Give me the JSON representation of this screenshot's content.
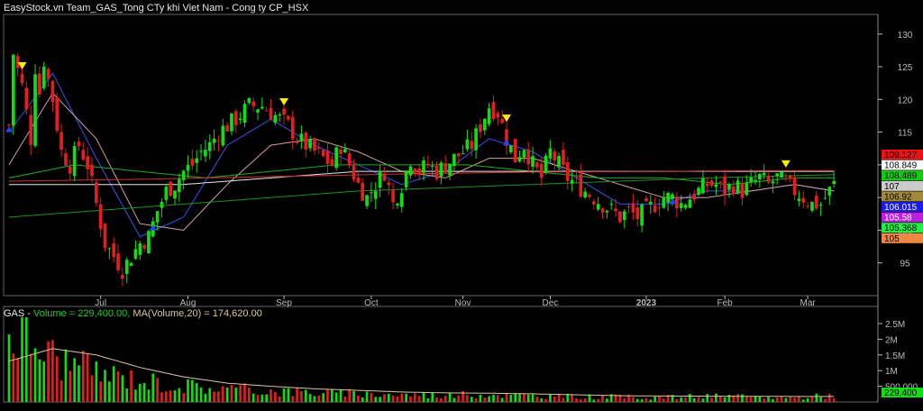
{
  "window": {
    "title": "EasyStock.vn Team_GAS_Tong CTy khi Viet Nam - Cong ty CP_HSX"
  },
  "volume_header": {
    "symbol": "GAS - ",
    "volume_text": "Volume = 229,400.00, ",
    "ma_text": "MA(Volume,20) = 174,620.00"
  },
  "colors": {
    "up": "#11dd11",
    "down": "#e21e1e",
    "background": "#000000",
    "axis": "#bbbbbb",
    "marker_yellow": "#ffee00",
    "marker_blue": "#2244ff"
  },
  "chart_data": [
    {
      "type": "candlestick",
      "title": "EasyStock.vn Team_GAS_Tong CTy khi Viet Nam - Cong ty CP_HSX",
      "ylim": [
        90,
        133
      ],
      "y_ticks": [
        95,
        100,
        105,
        110,
        115,
        120,
        125,
        130
      ],
      "x_labels": [
        "Jul",
        "Aug",
        "Sep",
        "Oct",
        "Nov",
        "Dec",
        "2023",
        "Feb",
        "Mar"
      ],
      "x_label_bar_index": [
        21,
        41,
        63,
        83,
        104,
        124,
        146,
        164,
        183
      ],
      "bar_count": 190,
      "close_anchors": [
        [
          0,
          116
        ],
        [
          1,
          127
        ],
        [
          3,
          122
        ],
        [
          5,
          114
        ],
        [
          6,
          125
        ],
        [
          7,
          121
        ],
        [
          8,
          126
        ],
        [
          10,
          120
        ],
        [
          12,
          112
        ],
        [
          14,
          110
        ],
        [
          16,
          113
        ],
        [
          18,
          110
        ],
        [
          20,
          104
        ],
        [
          22,
          98
        ],
        [
          24,
          96
        ],
        [
          26,
          94
        ],
        [
          28,
          96
        ],
        [
          30,
          98
        ],
        [
          32,
          99
        ],
        [
          34,
          103
        ],
        [
          36,
          106
        ],
        [
          38,
          107
        ],
        [
          40,
          109
        ],
        [
          42,
          110
        ],
        [
          44,
          112
        ],
        [
          46,
          113
        ],
        [
          48,
          115
        ],
        [
          50,
          116
        ],
        [
          52,
          117
        ],
        [
          55,
          119
        ],
        [
          58,
          119
        ],
        [
          60,
          118
        ],
        [
          62,
          117
        ],
        [
          64,
          116
        ],
        [
          66,
          114
        ],
        [
          68,
          113
        ],
        [
          70,
          112
        ],
        [
          72,
          111
        ],
        [
          74,
          110
        ],
        [
          76,
          113
        ],
        [
          78,
          110
        ],
        [
          80,
          107
        ],
        [
          82,
          105
        ],
        [
          84,
          107
        ],
        [
          86,
          109
        ],
        [
          88,
          104
        ],
        [
          90,
          107
        ],
        [
          92,
          111
        ],
        [
          94,
          109
        ],
        [
          96,
          110
        ],
        [
          98,
          109
        ],
        [
          100,
          110
        ],
        [
          102,
          111
        ],
        [
          104,
          112
        ],
        [
          106,
          113
        ],
        [
          108,
          116
        ],
        [
          110,
          119
        ],
        [
          112,
          118
        ],
        [
          114,
          114
        ],
        [
          116,
          111
        ],
        [
          118,
          113
        ],
        [
          120,
          110
        ],
        [
          122,
          108
        ],
        [
          124,
          112
        ],
        [
          126,
          110
        ],
        [
          128,
          108
        ],
        [
          130,
          107
        ],
        [
          132,
          106
        ],
        [
          134,
          105
        ],
        [
          136,
          104
        ],
        [
          138,
          103
        ],
        [
          140,
          102
        ],
        [
          142,
          103
        ],
        [
          144,
          102
        ],
        [
          146,
          103
        ],
        [
          148,
          104
        ],
        [
          150,
          105
        ],
        [
          152,
          105
        ],
        [
          154,
          104
        ],
        [
          156,
          105
        ],
        [
          158,
          106
        ],
        [
          160,
          107
        ],
        [
          162,
          107
        ],
        [
          164,
          106
        ],
        [
          166,
          107
        ],
        [
          168,
          106
        ],
        [
          170,
          107
        ],
        [
          172,
          108
        ],
        [
          174,
          107
        ],
        [
          176,
          108
        ],
        [
          178,
          107
        ],
        [
          180,
          106
        ],
        [
          182,
          105
        ],
        [
          184,
          104
        ],
        [
          186,
          104
        ],
        [
          188,
          106
        ],
        [
          189,
          107
        ]
      ],
      "series": [
        {
          "name": "",
          "color": "#3355ee",
          "anchors": [
            [
              0,
              115
            ],
            [
              10,
              124
            ],
            [
              20,
              111
            ],
            [
              30,
              99
            ],
            [
              40,
              102
            ],
            [
              50,
              113
            ],
            [
              60,
              117
            ],
            [
              70,
              113
            ],
            [
              80,
              110
            ],
            [
              90,
              107
            ],
            [
              100,
              109
            ],
            [
              110,
              114
            ],
            [
              120,
              112
            ],
            [
              130,
              108
            ],
            [
              140,
              104
            ],
            [
              150,
              104
            ],
            [
              160,
              106
            ],
            [
              170,
              106
            ],
            [
              180,
              107
            ],
            [
              189,
              106
            ]
          ]
        },
        {
          "name": "",
          "color": "#d4a0a0",
          "anchors": [
            [
              0,
              110
            ],
            [
              10,
              121
            ],
            [
              20,
              114
            ],
            [
              30,
              101
            ],
            [
              40,
              100
            ],
            [
              50,
              107
            ],
            [
              60,
              113
            ],
            [
              70,
              114
            ],
            [
              80,
              112
            ],
            [
              90,
              109
            ],
            [
              100,
              108
            ],
            [
              110,
              111
            ],
            [
              120,
              111
            ],
            [
              130,
              109
            ],
            [
              140,
              107
            ],
            [
              150,
              105
            ],
            [
              160,
              105
            ],
            [
              170,
              106
            ],
            [
              180,
              107
            ],
            [
              189,
              106
            ]
          ]
        },
        {
          "name": "",
          "color": "#22aa22",
          "anchors": [
            [
              0,
              108
            ],
            [
              15,
              110
            ],
            [
              30,
              109
            ],
            [
              45,
              108
            ],
            [
              60,
              109
            ],
            [
              75,
              110
            ],
            [
              90,
              110
            ],
            [
              105,
              110
            ],
            [
              120,
              109
            ],
            [
              135,
              108
            ],
            [
              150,
              108
            ],
            [
              165,
              107
            ],
            [
              180,
              108
            ],
            [
              189,
              108
            ]
          ]
        },
        {
          "name": "",
          "color": "#e8e8e8",
          "anchors": [
            [
              0,
              107
            ],
            [
              20,
              107
            ],
            [
              40,
              107
            ],
            [
              60,
              108
            ],
            [
              80,
              109
            ],
            [
              100,
              109
            ],
            [
              120,
              109
            ],
            [
              140,
              109
            ],
            [
              160,
              109
            ],
            [
              180,
              109
            ],
            [
              189,
              109
            ]
          ]
        },
        {
          "name": "",
          "color": "#cc3333",
          "anchors": [
            [
              0,
              107.5
            ],
            [
              30,
              107.8
            ],
            [
              60,
              108.2
            ],
            [
              90,
              108.6
            ],
            [
              120,
              108.9
            ],
            [
              150,
              109
            ],
            [
              170,
              109.1
            ],
            [
              189,
              109.1
            ]
          ]
        },
        {
          "name": "",
          "color": "#1f8f1f",
          "anchors": [
            [
              0,
              102
            ],
            [
              40,
              104
            ],
            [
              80,
              106
            ],
            [
              120,
              107
            ],
            [
              160,
              108
            ],
            [
              189,
              108.5
            ]
          ]
        }
      ],
      "markers_yellow": [
        3,
        63,
        114,
        178
      ],
      "markers_blue": [
        0,
        33,
        114,
        152
      ],
      "price_labels": [
        {
          "value": "109.127",
          "bg": "#ee1111",
          "fg": "#000000"
        },
        {
          "value": "108.849",
          "bg": "#ffffff",
          "fg": "#000000"
        },
        {
          "value": "108.489",
          "bg": "#11cc11",
          "fg": "#000000"
        },
        {
          "value": "107",
          "bg": "#cccccc",
          "fg": "#000000"
        },
        {
          "value": "106.92",
          "bg": "#a08a3a",
          "fg": "#000000"
        },
        {
          "value": "106.015",
          "bg": "#1a1aee",
          "fg": "#ffffff"
        },
        {
          "value": "105.58",
          "bg": "#bb22dd",
          "fg": "#ffffff"
        },
        {
          "value": "105.368",
          "bg": "#22ee44",
          "fg": "#000000"
        },
        {
          "value": "105",
          "bg": "#ee8844",
          "fg": "#000000"
        }
      ]
    },
    {
      "type": "bar",
      "title": "GAS - Volume = 229,400.00, MA(Volume,20) = 174,620.00",
      "ylim": [
        0,
        2700000
      ],
      "y_ticks": [
        {
          "value": 500000,
          "label": "500,000"
        },
        {
          "value": 1000000,
          "label": "1M"
        },
        {
          "value": 1500000,
          "label": "1.5M"
        },
        {
          "value": 2000000,
          "label": "2M"
        },
        {
          "value": 2500000,
          "label": "2.5M"
        }
      ],
      "last_value_label": "229,400",
      "volume_anchors": [
        [
          0,
          2400000
        ],
        [
          4,
          2200000
        ],
        [
          8,
          1700000
        ],
        [
          12,
          1400000
        ],
        [
          16,
          1200000
        ],
        [
          20,
          1000000
        ],
        [
          24,
          900000
        ],
        [
          28,
          800000
        ],
        [
          32,
          700000
        ],
        [
          36,
          600000
        ],
        [
          40,
          550000
        ],
        [
          50,
          450000
        ],
        [
          60,
          380000
        ],
        [
          70,
          320000
        ],
        [
          80,
          280000
        ],
        [
          90,
          250000
        ],
        [
          100,
          230000
        ],
        [
          110,
          260000
        ],
        [
          120,
          210000
        ],
        [
          130,
          180000
        ],
        [
          140,
          170000
        ],
        [
          150,
          160000
        ],
        [
          160,
          200000
        ],
        [
          170,
          170000
        ],
        [
          180,
          150000
        ],
        [
          189,
          229400
        ]
      ],
      "ma_anchors": [
        [
          0,
          1300000
        ],
        [
          10,
          1700000
        ],
        [
          20,
          1500000
        ],
        [
          30,
          1100000
        ],
        [
          40,
          800000
        ],
        [
          50,
          600000
        ],
        [
          60,
          500000
        ],
        [
          70,
          420000
        ],
        [
          80,
          370000
        ],
        [
          90,
          320000
        ],
        [
          100,
          290000
        ],
        [
          110,
          280000
        ],
        [
          120,
          260000
        ],
        [
          130,
          230000
        ],
        [
          140,
          200000
        ],
        [
          150,
          190000
        ],
        [
          160,
          185000
        ],
        [
          170,
          180000
        ],
        [
          180,
          176000
        ],
        [
          189,
          174620
        ]
      ]
    }
  ]
}
